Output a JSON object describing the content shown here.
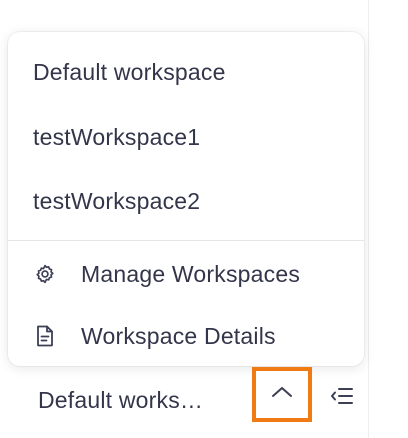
{
  "workspace_menu": {
    "workspaces": [
      {
        "label": "Default workspace"
      },
      {
        "label": "testWorkspace1"
      },
      {
        "label": "testWorkspace2"
      }
    ],
    "actions": [
      {
        "label": "Manage Workspaces",
        "icon": "gear-icon"
      },
      {
        "label": "Workspace Details",
        "icon": "document-icon"
      }
    ]
  },
  "bottom_bar": {
    "current_workspace": "Default works…",
    "toggle_icon": "chevron-up-icon",
    "collapse_icon": "collapse-sidebar-icon",
    "highlight_color": "#f07a14"
  },
  "colors": {
    "text": "#33364a",
    "icon": "#3c3f55",
    "separator": "#e6e6ea"
  }
}
